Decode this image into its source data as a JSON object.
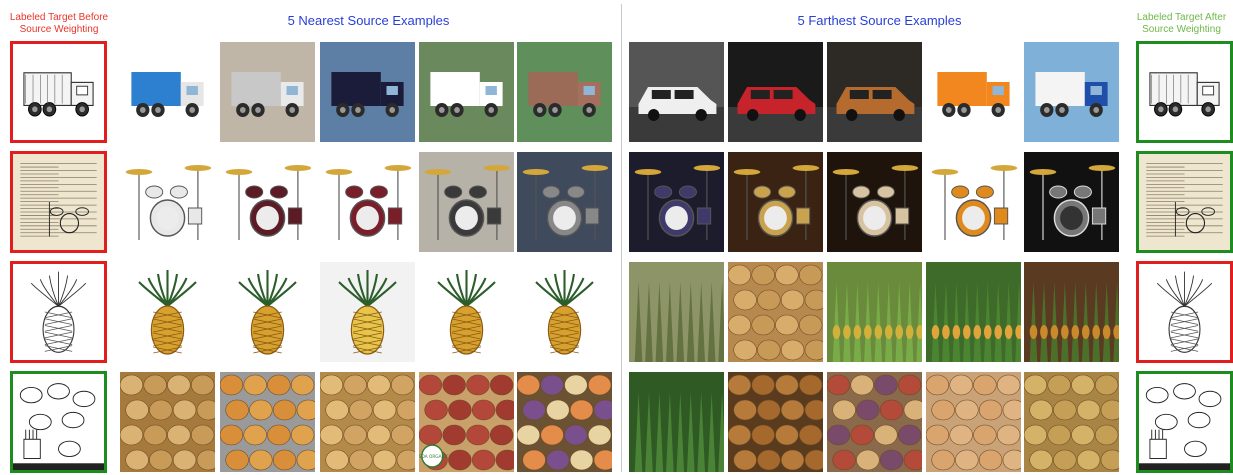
{
  "headers": {
    "before": "Labeled Target Before\nSource Weighting",
    "nearest": "5 Nearest Source Examples",
    "farthest": "5 Farthest Source Examples",
    "after": "Labeled Target After\nSource Weighting"
  },
  "colors": {
    "before_header": "#e8342a",
    "after_header": "#6fb84a",
    "nearest_header": "#2a3fd6",
    "farthest_header": "#2a3fd6",
    "wrong_border": "#e21d1d",
    "right_border": "#1e8c1e"
  },
  "rows": [
    {
      "category": "truck",
      "target_before_status": "wrong",
      "target_after_status": "right",
      "target_icon": "truck-sketch-icon",
      "nearest_icons": [
        "toy-dump-truck-icon",
        "dump-truck-icon",
        "box-truck-icon",
        "garbage-truck-icon",
        "semi-truck-icon"
      ],
      "farthest_icons": [
        "white-suv-icon",
        "red-sports-car-icon",
        "pickup-truck-icon",
        "orange-semi-trucks-icon",
        "blue-semi-truck-icon"
      ]
    },
    {
      "category": "drum",
      "target_before_status": "wrong",
      "target_after_status": "right",
      "target_icon": "drum-dictionary-print-icon",
      "nearest_icons": [
        "drum-kit-icon",
        "maroon-drum-kit-icon",
        "red-drum-kit-icon",
        "drum-kit-room-icon",
        "drum-kit-stage-icon"
      ],
      "farthest_icons": [
        "drum-kit-purple-light-icon",
        "drumsticks-icon",
        "drum-closeup-icon",
        "orange-drum-kit-icon",
        "drum-kit-bw-icon"
      ]
    },
    {
      "category": "pineapple",
      "target_before_status": "wrong",
      "target_after_status": "wrong",
      "target_icon": "pineapple-sketch-icon",
      "nearest_icons": [
        "pineapple-icon",
        "pineapple-icon",
        "pineapple-halves-icon",
        "pineapple-icon",
        "pineapple-icon"
      ],
      "farthest_icons": [
        "pineapple-field-icon",
        "pineapple-pie-icon",
        "pineapple-rows-icon",
        "pineapple-farm-icon",
        "pineapple-plants-icon"
      ]
    },
    {
      "category": "potato",
      "target_before_status": "right",
      "target_after_status": "right",
      "target_icon": "potato-sketch-icon",
      "nearest_icons": [
        "potatoes-icon",
        "potato-wedges-icon",
        "baby-potatoes-icon",
        "red-potatoes-usda-icon",
        "potato-slices-icon"
      ],
      "farthest_icons": [
        "potato-plants-icon",
        "potatoes-pile-icon",
        "mixed-potatoes-icon",
        "russet-potatoes-icon",
        "potatoes-closeup-icon"
      ]
    }
  ],
  "badge_text": "USDA ORGANIC"
}
